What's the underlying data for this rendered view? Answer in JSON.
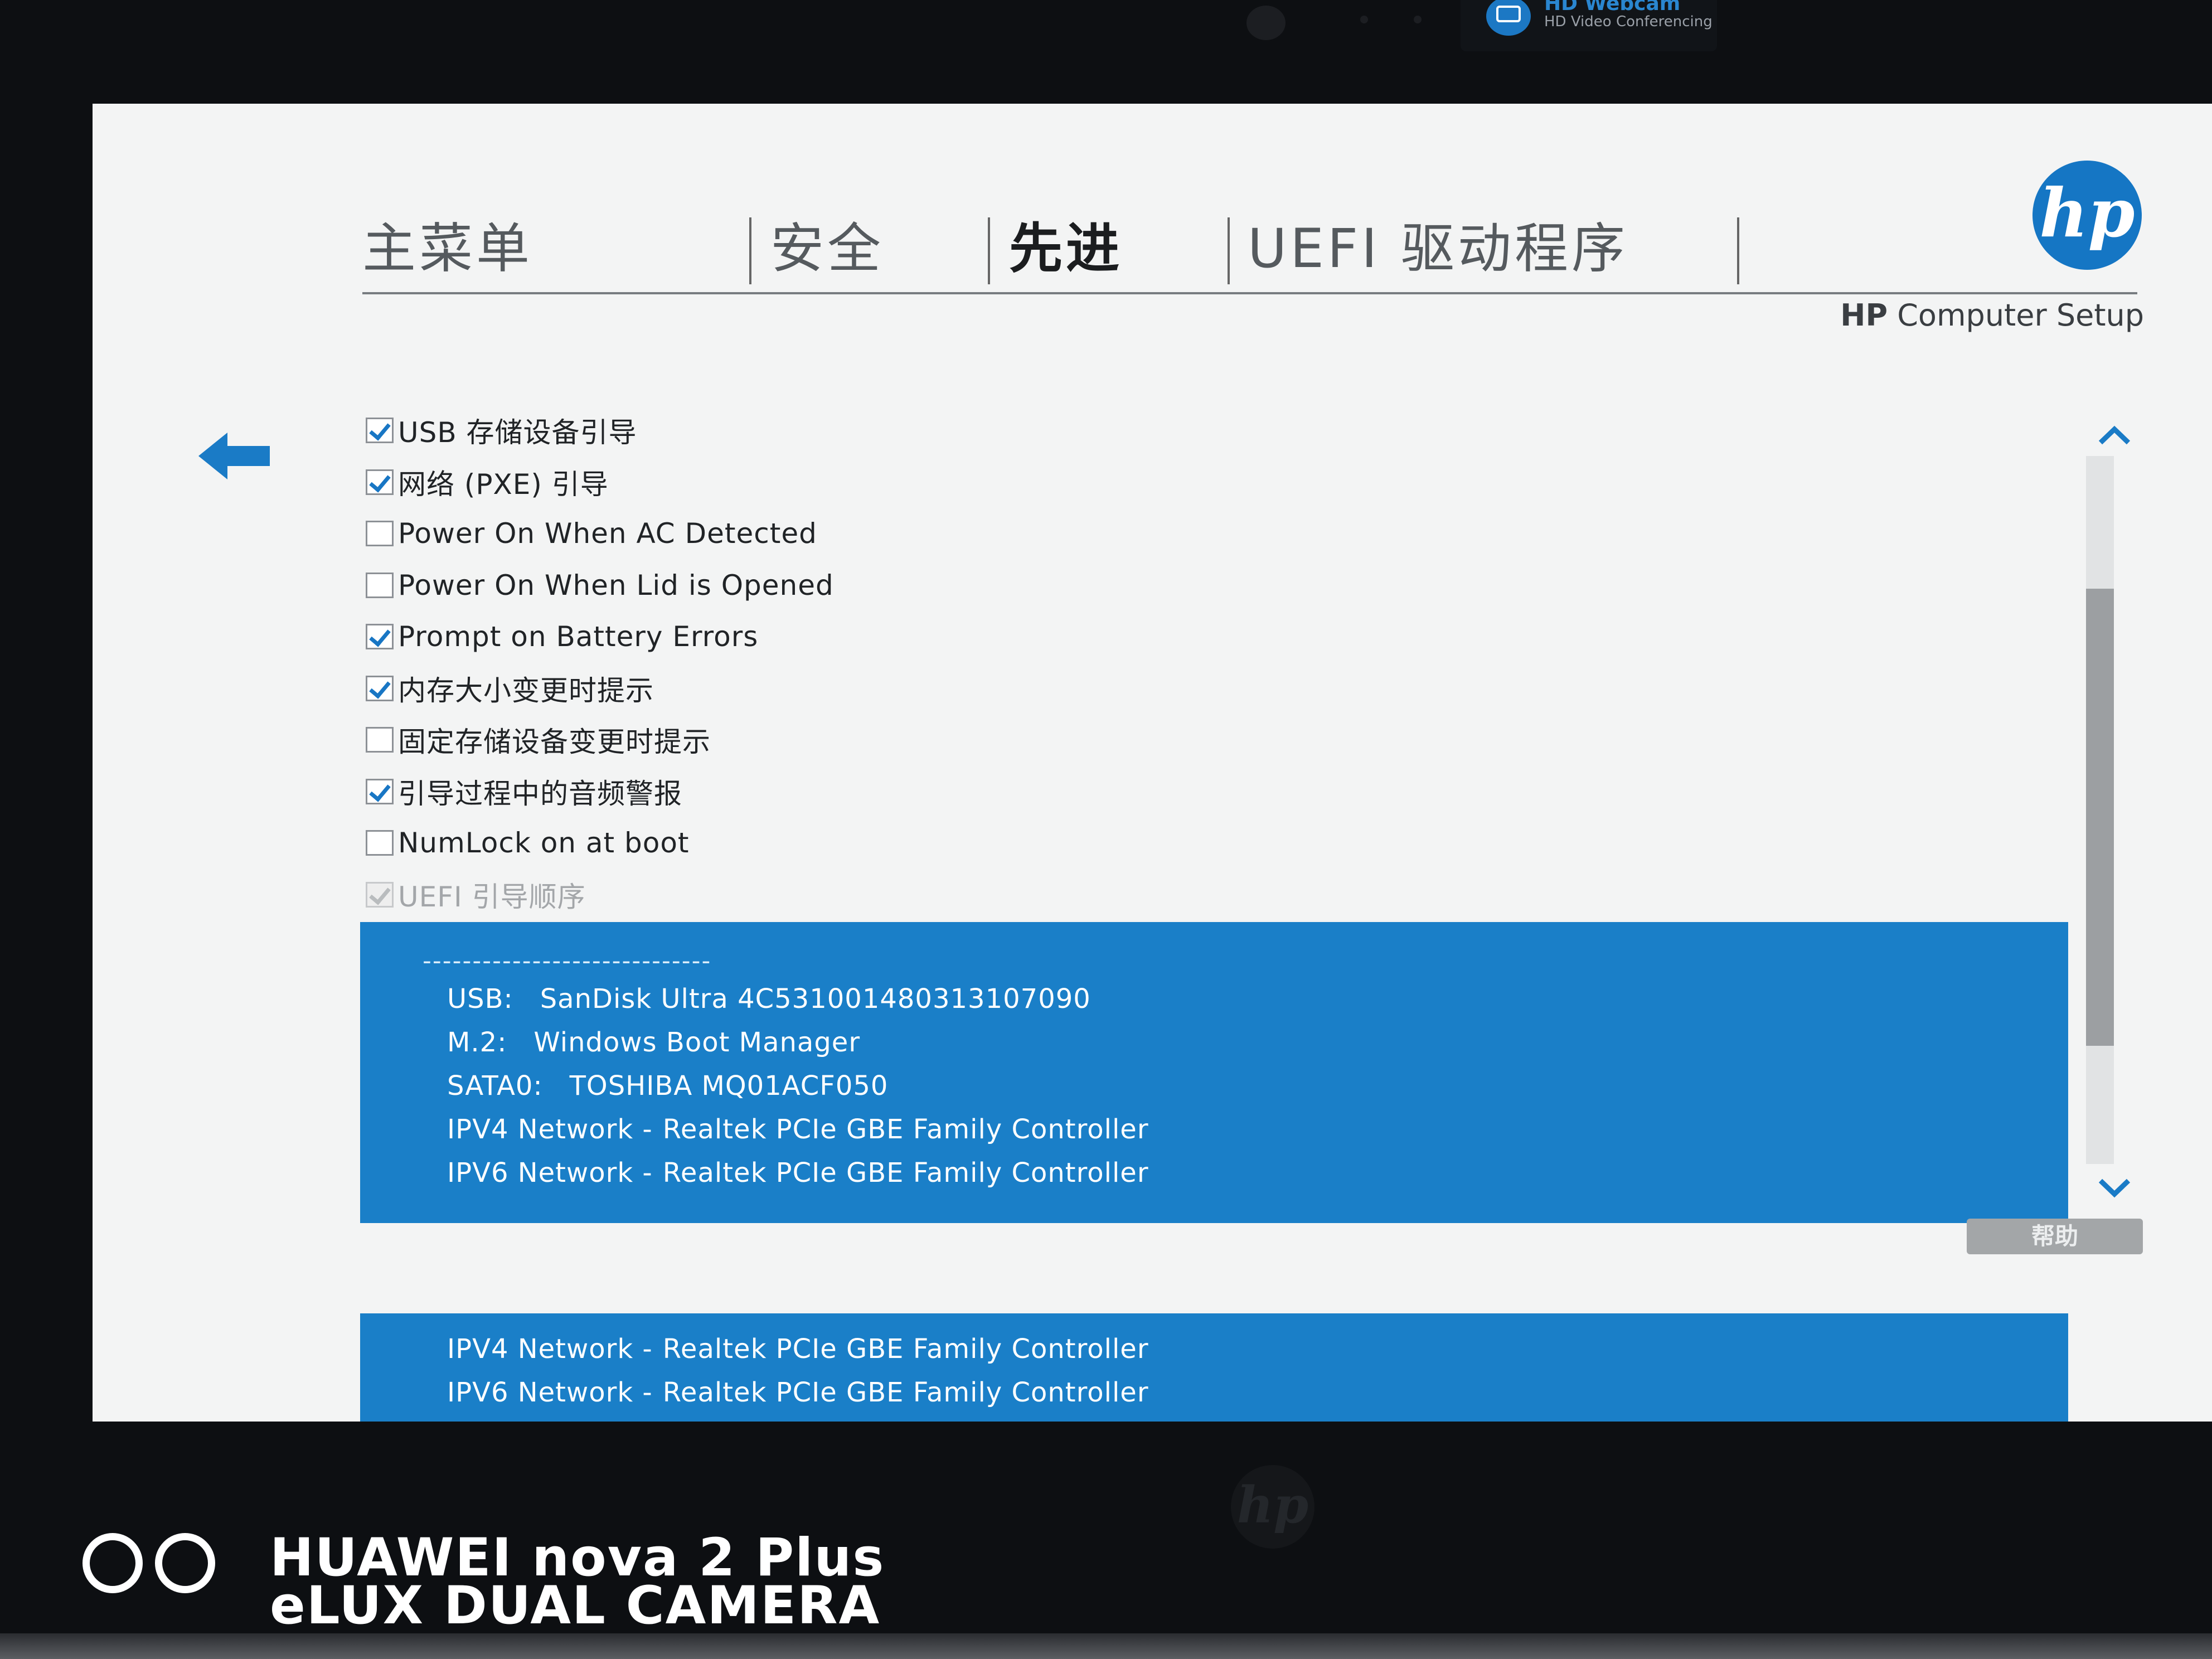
{
  "bezel": {
    "webcam_title": "HD Webcam",
    "webcam_subtitle": "HD Video Conferencing"
  },
  "header": {
    "tabs": [
      {
        "label": "主菜单",
        "active": false
      },
      {
        "label": "安全",
        "active": false
      },
      {
        "label": "先进",
        "active": true
      },
      {
        "label": "UEFI 驱动程序",
        "active": false
      }
    ],
    "logo_text": "hp",
    "setup_brand": "HP",
    "setup_title": "Computer Setup"
  },
  "options": [
    {
      "label": "USB 存储设备引导",
      "checked": true,
      "disabled": false
    },
    {
      "label": "网络 (PXE) 引导",
      "checked": true,
      "disabled": false
    },
    {
      "label": "Power On When AC Detected",
      "checked": false,
      "disabled": false
    },
    {
      "label": "Power On When Lid is Opened",
      "checked": false,
      "disabled": false
    },
    {
      "label": "Prompt on Battery Errors",
      "checked": true,
      "disabled": false
    },
    {
      "label": "内存大小变更时提示",
      "checked": true,
      "disabled": false
    },
    {
      "label": "固定存储设备变更时提示",
      "checked": false,
      "disabled": false
    },
    {
      "label": "引导过程中的音频警报",
      "checked": true,
      "disabled": false
    },
    {
      "label": "NumLock on at boot",
      "checked": false,
      "disabled": false
    },
    {
      "label": "UEFI 引导顺序",
      "checked": true,
      "disabled": true
    }
  ],
  "boot_order": {
    "separator": "-----------------------------",
    "entries": [
      {
        "key": "USB:",
        "value": "SanDisk Ultra 4C531001480313107090"
      },
      {
        "key": "M.2:",
        "value": "Windows Boot Manager"
      },
      {
        "key": "SATA0:",
        "value": "TOSHIBA MQ01ACF050"
      },
      {
        "key": "IPV4 Network -",
        "value": "Realtek PCIe GBE Family Controller"
      },
      {
        "key": "IPV6 Network -",
        "value": "Realtek PCIe GBE Family Controller"
      }
    ],
    "ghost_entries": [
      {
        "key": "IPV4 Network -",
        "value": "Realtek PCIe GBE Family Controller"
      },
      {
        "key": "IPV6 Network -",
        "value": "Realtek PCIe GBE Family Controller"
      }
    ]
  },
  "help_label": "帮助",
  "watermark": {
    "line1": "HUAWEI nova 2 Plus",
    "line2": "eLUX DUAL CAMERA"
  },
  "colors": {
    "accent": "#1a7fc8",
    "screen_bg": "#f3f4f4",
    "bezel": "#0d0f12"
  }
}
